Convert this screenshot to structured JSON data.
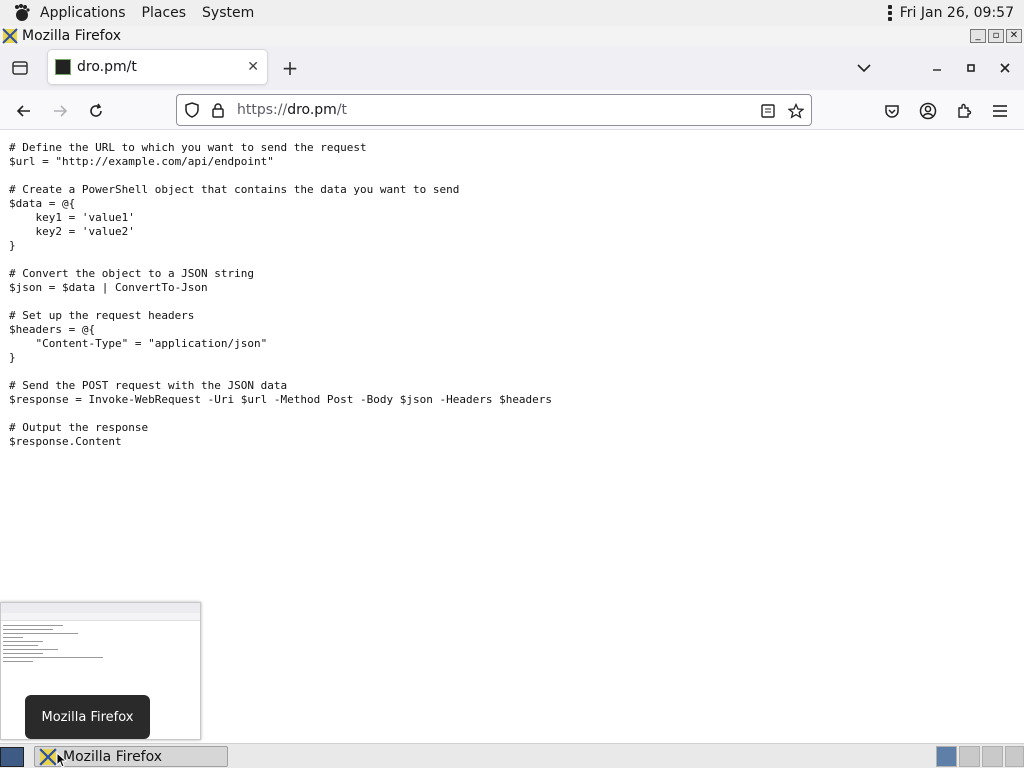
{
  "topbar": {
    "menus": [
      "Applications",
      "Places",
      "System"
    ],
    "clock": "Fri Jan 26, 09:57"
  },
  "window": {
    "title": "Mozilla Firefox"
  },
  "tab": {
    "title": "dro.pm/t"
  },
  "urlbar": {
    "scheme": "https://",
    "host": "dro.pm",
    "path": "/t"
  },
  "page": {
    "code": "# Define the URL to which you want to send the request\n$url = \"http://example.com/api/endpoint\"\n\n# Create a PowerShell object that contains the data you want to send\n$data = @{\n    key1 = 'value1'\n    key2 = 'value2'\n}\n\n# Convert the object to a JSON string\n$json = $data | ConvertTo-Json\n\n# Set up the request headers\n$headers = @{\n    \"Content-Type\" = \"application/json\"\n}\n\n# Send the POST request with the JSON data\n$response = Invoke-WebRequest -Uri $url -Method Post -Body $json -Headers $headers\n\n# Output the response\n$response.Content"
  },
  "tooltip": {
    "text": "Mozilla Firefox"
  },
  "taskbar": {
    "task_label": "Mozilla Firefox"
  },
  "colors": {
    "accent": "#0060df",
    "workspace_active": "#5d7fa8"
  }
}
